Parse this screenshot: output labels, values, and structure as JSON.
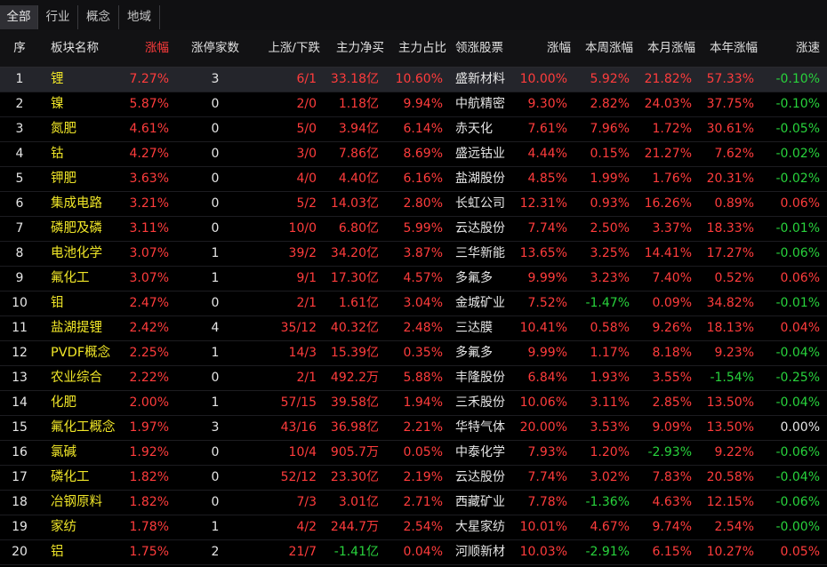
{
  "tabs": [
    {
      "label": "全部",
      "active": true
    },
    {
      "label": "行业",
      "active": false
    },
    {
      "label": "概念",
      "active": false
    },
    {
      "label": "地域",
      "active": false
    }
  ],
  "columns": [
    "序",
    "板块名称",
    "涨幅",
    "涨停家数",
    "上涨/下跌",
    "主力净买",
    "主力占比",
    "领涨股票",
    "涨幅",
    "本周涨幅",
    "本月涨幅",
    "本年涨幅",
    "涨速"
  ],
  "sorted_column_index": 2,
  "selected_row_index": 0,
  "colors": {
    "up": "#ff3c3c",
    "down": "#28d23c",
    "name": "#f0e628",
    "neutral": "#e6e6e6"
  },
  "rows": [
    {
      "idx": "1",
      "name": "锂",
      "chg": "7.27%",
      "limit": "3",
      "updown": "6/1",
      "net": "33.18亿",
      "ratio": "10.60%",
      "stock": "盛新材料",
      "schg": "10.00%",
      "week": "5.92%",
      "month": "21.82%",
      "year": "57.33%",
      "speed": "-0.10%"
    },
    {
      "idx": "2",
      "name": "镍",
      "chg": "5.87%",
      "limit": "0",
      "updown": "2/0",
      "net": "1.18亿",
      "ratio": "9.94%",
      "stock": "中航精密",
      "schg": "9.30%",
      "week": "2.82%",
      "month": "24.03%",
      "year": "37.75%",
      "speed": "-0.10%"
    },
    {
      "idx": "3",
      "name": "氮肥",
      "chg": "4.61%",
      "limit": "0",
      "updown": "5/0",
      "net": "3.94亿",
      "ratio": "6.14%",
      "stock": "赤天化",
      "schg": "7.61%",
      "week": "7.96%",
      "month": "1.72%",
      "year": "30.61%",
      "speed": "-0.05%"
    },
    {
      "idx": "4",
      "name": "钴",
      "chg": "4.27%",
      "limit": "0",
      "updown": "3/0",
      "net": "7.86亿",
      "ratio": "8.69%",
      "stock": "盛远钴业",
      "schg": "4.44%",
      "week": "0.15%",
      "month": "21.27%",
      "year": "7.62%",
      "speed": "-0.02%"
    },
    {
      "idx": "5",
      "name": "钾肥",
      "chg": "3.63%",
      "limit": "0",
      "updown": "4/0",
      "net": "4.40亿",
      "ratio": "6.16%",
      "stock": "盐湖股份",
      "schg": "4.85%",
      "week": "1.99%",
      "month": "1.76%",
      "year": "20.31%",
      "speed": "-0.02%"
    },
    {
      "idx": "6",
      "name": "集成电路",
      "chg": "3.21%",
      "limit": "0",
      "updown": "5/2",
      "net": "14.03亿",
      "ratio": "2.80%",
      "stock": "长虹公司",
      "schg": "12.31%",
      "week": "0.93%",
      "month": "16.26%",
      "year": "0.89%",
      "speed": "0.06%"
    },
    {
      "idx": "7",
      "name": "磷肥及磷",
      "chg": "3.11%",
      "limit": "0",
      "updown": "10/0",
      "net": "6.80亿",
      "ratio": "5.99%",
      "stock": "云达股份",
      "schg": "7.74%",
      "week": "2.50%",
      "month": "3.37%",
      "year": "18.33%",
      "speed": "-0.01%"
    },
    {
      "idx": "8",
      "name": "电池化学",
      "chg": "3.07%",
      "limit": "1",
      "updown": "39/2",
      "net": "34.20亿",
      "ratio": "3.87%",
      "stock": "三华新能",
      "schg": "13.65%",
      "week": "3.25%",
      "month": "14.41%",
      "year": "17.27%",
      "speed": "-0.06%"
    },
    {
      "idx": "9",
      "name": "氟化工",
      "chg": "3.07%",
      "limit": "1",
      "updown": "9/1",
      "net": "17.30亿",
      "ratio": "4.57%",
      "stock": "多氟多",
      "schg": "9.99%",
      "week": "3.23%",
      "month": "7.40%",
      "year": "0.52%",
      "speed": "0.06%"
    },
    {
      "idx": "10",
      "name": "钼",
      "chg": "2.47%",
      "limit": "0",
      "updown": "2/1",
      "net": "1.61亿",
      "ratio": "3.04%",
      "stock": "金城矿业",
      "schg": "7.52%",
      "week": "-1.47%",
      "month": "0.09%",
      "year": "34.82%",
      "speed": "-0.01%"
    },
    {
      "idx": "11",
      "name": "盐湖提锂",
      "chg": "2.42%",
      "limit": "4",
      "updown": "35/12",
      "net": "40.32亿",
      "ratio": "2.48%",
      "stock": "三达膜",
      "schg": "10.41%",
      "week": "0.58%",
      "month": "9.26%",
      "year": "18.13%",
      "speed": "0.04%"
    },
    {
      "idx": "12",
      "name": "PVDF概念",
      "chg": "2.25%",
      "limit": "1",
      "updown": "14/3",
      "net": "15.39亿",
      "ratio": "0.35%",
      "stock": "多氟多",
      "schg": "9.99%",
      "week": "1.17%",
      "month": "8.18%",
      "year": "9.23%",
      "speed": "-0.04%"
    },
    {
      "idx": "13",
      "name": "农业综合",
      "chg": "2.22%",
      "limit": "0",
      "updown": "2/1",
      "net": "492.2万",
      "ratio": "5.88%",
      "stock": "丰隆股份",
      "schg": "6.84%",
      "week": "1.93%",
      "month": "3.55%",
      "year": "-1.54%",
      "speed": "-0.25%"
    },
    {
      "idx": "14",
      "name": "化肥",
      "chg": "2.00%",
      "limit": "1",
      "updown": "57/15",
      "net": "39.58亿",
      "ratio": "1.94%",
      "stock": "三禾股份",
      "schg": "10.06%",
      "week": "3.11%",
      "month": "2.85%",
      "year": "13.50%",
      "speed": "-0.04%"
    },
    {
      "idx": "15",
      "name": "氟化工概念",
      "chg": "1.97%",
      "limit": "3",
      "updown": "43/16",
      "net": "36.98亿",
      "ratio": "2.21%",
      "stock": "华特气体",
      "schg": "20.00%",
      "week": "3.53%",
      "month": "9.09%",
      "year": "13.50%",
      "speed": "0.00%"
    },
    {
      "idx": "16",
      "name": "氯碱",
      "chg": "1.92%",
      "limit": "0",
      "updown": "10/4",
      "net": "905.7万",
      "ratio": "0.05%",
      "stock": "中泰化学",
      "schg": "7.93%",
      "week": "1.20%",
      "month": "-2.93%",
      "year": "9.22%",
      "speed": "-0.06%"
    },
    {
      "idx": "17",
      "name": "磷化工",
      "chg": "1.82%",
      "limit": "0",
      "updown": "52/12",
      "net": "23.30亿",
      "ratio": "2.19%",
      "stock": "云达股份",
      "schg": "7.74%",
      "week": "3.02%",
      "month": "7.83%",
      "year": "20.58%",
      "speed": "-0.04%"
    },
    {
      "idx": "18",
      "name": "冶钢原料",
      "chg": "1.82%",
      "limit": "0",
      "updown": "7/3",
      "net": "3.01亿",
      "ratio": "2.71%",
      "stock": "西藏矿业",
      "schg": "7.78%",
      "week": "-1.36%",
      "month": "4.63%",
      "year": "12.15%",
      "speed": "-0.06%"
    },
    {
      "idx": "19",
      "name": "家纺",
      "chg": "1.78%",
      "limit": "1",
      "updown": "4/2",
      "net": "244.7万",
      "ratio": "2.54%",
      "stock": "大星家纺",
      "schg": "10.01%",
      "week": "4.67%",
      "month": "9.74%",
      "year": "2.54%",
      "speed": "-0.00%"
    },
    {
      "idx": "20",
      "name": "铝",
      "chg": "1.75%",
      "limit": "2",
      "updown": "21/7",
      "net": "-1.41亿",
      "ratio": "0.04%",
      "stock": "河顺新材",
      "schg": "10.03%",
      "week": "-2.91%",
      "month": "6.15%",
      "year": "10.27%",
      "speed": "0.05%"
    }
  ]
}
